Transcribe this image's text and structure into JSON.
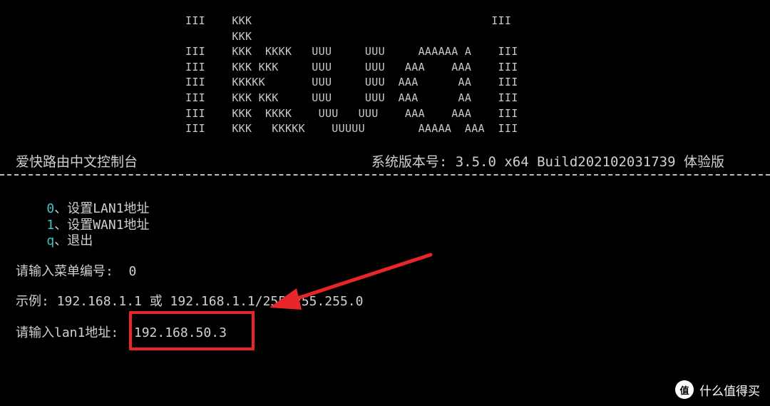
{
  "banner": {
    "lines": [
      "III    KKK                                    III",
      "       KKK",
      "III    KKK  KKKK   UUU     UUU     AAAAAA A    III",
      "III    KKK KKK     UUU     UUU   AAA    AAA    III",
      "III    KKKKK       UUU     UUU  AAA      AA    III",
      "III    KKK KKK     UUU     UUU  AAA      AA    III",
      "III    KKK  KKKK    UUU   UUU    AAA    AAA    III",
      "III    KKK   KKKKK    UUUUU        AAAAA  AAA  III"
    ]
  },
  "header": {
    "title": "爱快路由中文控制台",
    "version": "系统版本号: 3.5.0 x64 Build202102031739 体验版"
  },
  "menu": {
    "items": [
      {
        "key": "0",
        "label": "、设置LAN1地址"
      },
      {
        "key": "1",
        "label": "、设置WAN1地址"
      },
      {
        "key": "q",
        "label": "、退出"
      }
    ]
  },
  "prompts": {
    "menu_prompt": "请输入菜单编号:  0",
    "example": "示例: 192.168.1.1 或 192.168.1.1/255.255.255.0",
    "lan_prompt": "请输入lan1地址:  192.168.50.3"
  },
  "colors": {
    "background": "#000000",
    "text": "#d0d0d0",
    "menu_key": "#3fc6c6",
    "annotation": "#e8262a"
  },
  "watermark": {
    "logo_text": "值",
    "text": "什么值得买"
  }
}
